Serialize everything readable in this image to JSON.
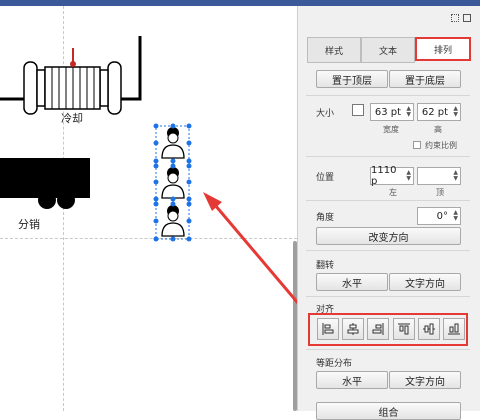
{
  "canvas": {
    "label_cooling": "冷却",
    "label_distribution": "分销"
  },
  "panel": {
    "tabs": [
      {
        "label": "样式"
      },
      {
        "label": "文本"
      },
      {
        "label": "排列",
        "active": true
      }
    ],
    "order": {
      "to_front": "置于顶层",
      "to_back": "置于底层"
    },
    "size": {
      "label": "大小",
      "width_value": "63 pt",
      "height_value": "62 pt",
      "width_caption": "宽度",
      "height_caption": "高",
      "constrain_label": "约束比例"
    },
    "position": {
      "label": "位置",
      "left_value": "1110 p",
      "top_value": "",
      "left_caption": "左",
      "top_caption": "顶"
    },
    "angle": {
      "label": "角度",
      "value": "0°",
      "rotate_button": "改变方向"
    },
    "flip": {
      "label": "翻转",
      "horizontal": "水平",
      "text_direction": "文字方向"
    },
    "align": {
      "label": "对齐",
      "buttons": [
        "align-left-icon",
        "align-center-icon",
        "align-right-icon",
        "align-top-icon",
        "align-middle-icon",
        "align-bottom-icon"
      ]
    },
    "distribute": {
      "label": "等距分布",
      "horizontal": "水平",
      "vertical": "文字方向"
    },
    "group_button": "组合"
  },
  "colors": {
    "highlight": "#e53935",
    "selection": "#1e73e8",
    "topbar": "#3b5998"
  }
}
